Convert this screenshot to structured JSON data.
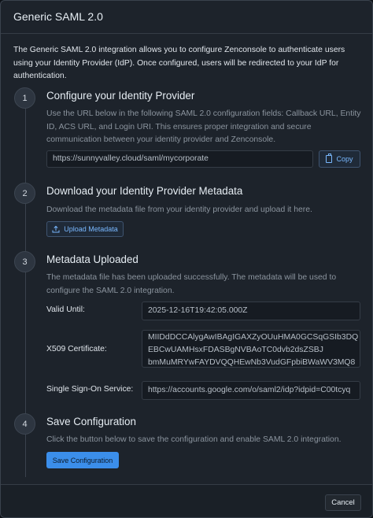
{
  "dialog": {
    "title": "Generic SAML 2.0",
    "intro": "The Generic SAML 2.0 integration allows you to configure Zenconsole to authenticate users using your Identity Provider (IdP). Once configured, users will be redirected to your IdP for authentication."
  },
  "steps": [
    {
      "number": "1",
      "title": "Configure your Identity Provider",
      "description": "Use the URL below in the following SAML 2.0 configuration fields: Callback URL, Entity ID, ACS URL, and Login URI. This ensures proper integration and secure communication between your identity provider and Zenconsole.",
      "url_value": "https://sunnyvalley.cloud/saml/mycorporate",
      "copy_label": "Copy"
    },
    {
      "number": "2",
      "title": "Download your Identity Provider Metadata",
      "description": "Download the metadata file from your identity provider and upload it here.",
      "upload_label": "Upload Metadata"
    },
    {
      "number": "3",
      "title": "Metadata Uploaded",
      "description": "The metadata file has been uploaded successfully. The metadata will be used to configure the SAML 2.0 integration.",
      "fields": {
        "valid_until_label": "Valid Until:",
        "valid_until_value": "2025-12-16T19:42:05.000Z",
        "x509_label": "X509 Certificate:",
        "x509_lines": [
          "MIIDdDCCAlygAwIBAgIGAXZyOUuHMA0GCSqGSIb3DQ",
          "EBCwUAMHsxFDASBgNVBAoTC0dvb2dsZSBJ",
          "bmMuMRYwFAYDVQQHEwNb3VudGFpbiBWaWV3MQ8"
        ],
        "sso_label": "Single Sign-On Service:",
        "sso_value": "https://accounts.google.com/o/saml2/idp?idpid=C00tcyq"
      }
    },
    {
      "number": "4",
      "title": "Save Configuration",
      "description": "Click the button below to save the configuration and enable SAML 2.0 integration.",
      "save_label": "Save Configuration"
    }
  ],
  "footer": {
    "cancel_label": "Cancel"
  },
  "colors": {
    "accent": "#3b8eea",
    "link": "#79b8ff",
    "background": "#1d232b"
  },
  "icons": {
    "copy": "copy-icon",
    "upload": "upload-icon"
  }
}
